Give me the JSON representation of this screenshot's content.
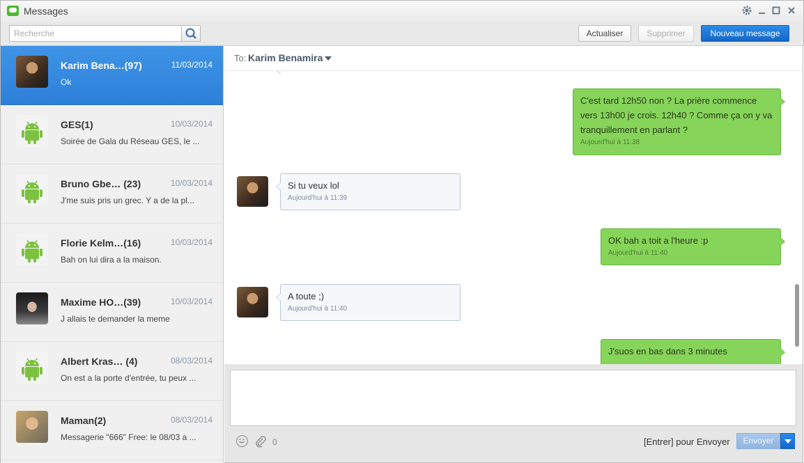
{
  "window": {
    "title": "Messages"
  },
  "toolbar": {
    "search_placeholder": "Recherche",
    "refresh_label": "Actualiser",
    "delete_label": "Supprimer",
    "new_message_label": "Nouveau message"
  },
  "conversations": [
    {
      "name": "Karim Bena…(97)",
      "date": "11/03/2014",
      "preview": "Ok",
      "avatar": "photo",
      "selected": true
    },
    {
      "name": "GES(1)",
      "date": "10/03/2014",
      "preview": "Soirée de Gala du Réseau GES, le ...",
      "avatar": "android-icon"
    },
    {
      "name": "Bruno Gbe…  (23)",
      "date": "10/03/2014",
      "preview": "J'me suis pris un grec. Y a de la pl...",
      "avatar": "android-icon"
    },
    {
      "name": "Florie Kelm…(16)",
      "date": "10/03/2014",
      "preview": "Bah on lui dira a la maison.",
      "avatar": "android-icon"
    },
    {
      "name": "Maxime HO…(39)",
      "date": "10/03/2014",
      "preview": "J allais te demander la meme",
      "avatar": "photo"
    },
    {
      "name": "Albert Kras…  (4)",
      "date": "08/03/2014",
      "preview": "On est a la porte d'entrée, tu peux ...",
      "avatar": "android-icon"
    },
    {
      "name": "Maman(2)",
      "date": "08/03/2014",
      "preview": "Messagerie \"666\" Free: le 08/03 a ...",
      "avatar": "photo"
    }
  ],
  "chat": {
    "to_label": "To:",
    "recipient": "Karim Benamira",
    "messages": [
      {
        "direction": "out",
        "text": "C'est tard 12h50 non ? La prière commence vers 13h00 je crois. 12h40 ? Comme ça on y va tranquillement en parlant ?",
        "time": "Aujourd'hui à 11:38"
      },
      {
        "direction": "in",
        "text": "Si tu veux lol",
        "time": "Aujourd'hui à 11:39"
      },
      {
        "direction": "out",
        "text": "OK bah a toit a l'heure :p",
        "time": "Aujourd'hui à 11:40"
      },
      {
        "direction": "in",
        "text": "A toute ;)",
        "time": "Aujourd'hui à 11:40"
      },
      {
        "direction": "out",
        "text": "J'suos en bas dans 3 minutes",
        "time": ""
      }
    ]
  },
  "composer": {
    "attachment_count": "0",
    "enter_hint": "[Entrer] pour Envoyer",
    "send_label": "Envoyer"
  },
  "colors": {
    "accent": "#1a6fd4",
    "outgoing_bubble": "#86d45a",
    "selected_row": "#3589e0"
  }
}
